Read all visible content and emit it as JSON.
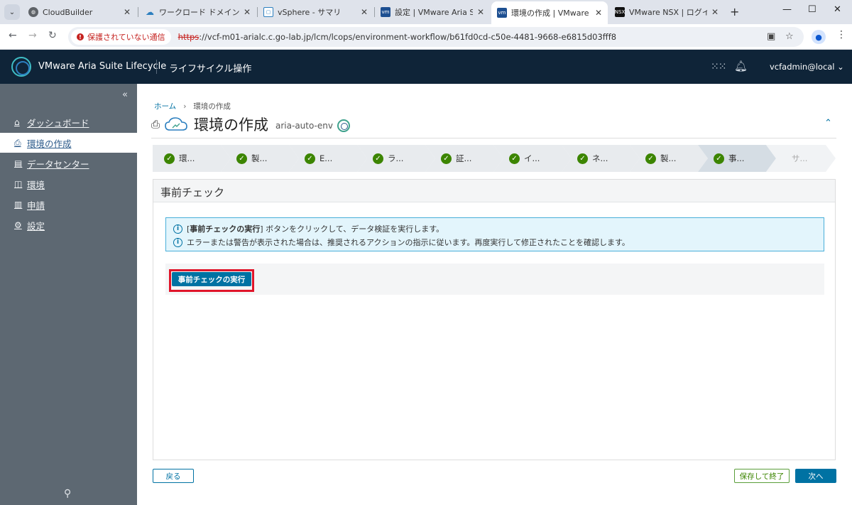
{
  "browser": {
    "tabs": [
      {
        "title": "CloudBuilder",
        "favicon": "globe-icon",
        "active": false
      },
      {
        "title": "ワークロード ドメイン - サービス",
        "favicon": "cloud-icon",
        "active": false
      },
      {
        "title": "vSphere - サマリ",
        "favicon": "vsphere-icon",
        "active": false
      },
      {
        "title": "設定 | VMware Aria Suite",
        "favicon": "vmware-icon",
        "active": false
      },
      {
        "title": "環境の作成 | VMware Aria",
        "favicon": "vmware-icon",
        "active": true
      },
      {
        "title": "VMware NSX | ログイン",
        "favicon": "nsx-icon",
        "active": false
      }
    ],
    "security_warning": "保護されていない通信",
    "url_scheme": "https",
    "url_rest": "://vcf-m01-arialc.c.go-lab.jp/lcm/lcops/environment-workflow/b61fd0cd-c50e-4481-9668-e6815d03fff8"
  },
  "app": {
    "name": "VMware Aria Suite Lifecycle",
    "section": "ライフサイクル操作",
    "user": "vcfadmin@local",
    "header_bg": "#0f2438"
  },
  "sidebar": {
    "items": [
      {
        "label": "ダッシュボード",
        "icon": "home-icon",
        "active": false
      },
      {
        "label": "環境の作成",
        "icon": "lock-icon",
        "active": true
      },
      {
        "label": "データセンター",
        "icon": "datacenter-icon",
        "active": false
      },
      {
        "label": "環境",
        "icon": "environment-icon",
        "active": false
      },
      {
        "label": "申請",
        "icon": "request-icon",
        "active": false
      },
      {
        "label": "設定",
        "icon": "gear-icon",
        "active": false
      }
    ]
  },
  "page": {
    "breadcrumb_home": "ホーム",
    "breadcrumb_current": "環境の作成",
    "title": "環境の作成",
    "env_name": "aria-auto-env"
  },
  "stepper": {
    "steps": [
      {
        "label": "環...",
        "state": "done"
      },
      {
        "label": "製...",
        "state": "done"
      },
      {
        "label": "E...",
        "state": "done"
      },
      {
        "label": "ラ...",
        "state": "done"
      },
      {
        "label": "証...",
        "state": "done"
      },
      {
        "label": "イ...",
        "state": "done"
      },
      {
        "label": "ネ...",
        "state": "done"
      },
      {
        "label": "製...",
        "state": "done"
      },
      {
        "label": "事...",
        "state": "current"
      },
      {
        "label": "サ...",
        "state": "pending"
      }
    ]
  },
  "panel": {
    "title": "事前チェック",
    "info_line1_bracket_open": "[",
    "info_line1_bold": "事前チェックの実行",
    "info_line1_rest": "] ボタンをクリックして、データ検証を実行します。",
    "info_line2": "エラーまたは警告が表示された場合は、推奨されるアクションの指示に従います。再度実行して修正されたことを確認します。",
    "run_button": "事前チェックの実行"
  },
  "footer": {
    "back": "戻る",
    "save_exit": "保存して終了",
    "next": "次へ"
  }
}
